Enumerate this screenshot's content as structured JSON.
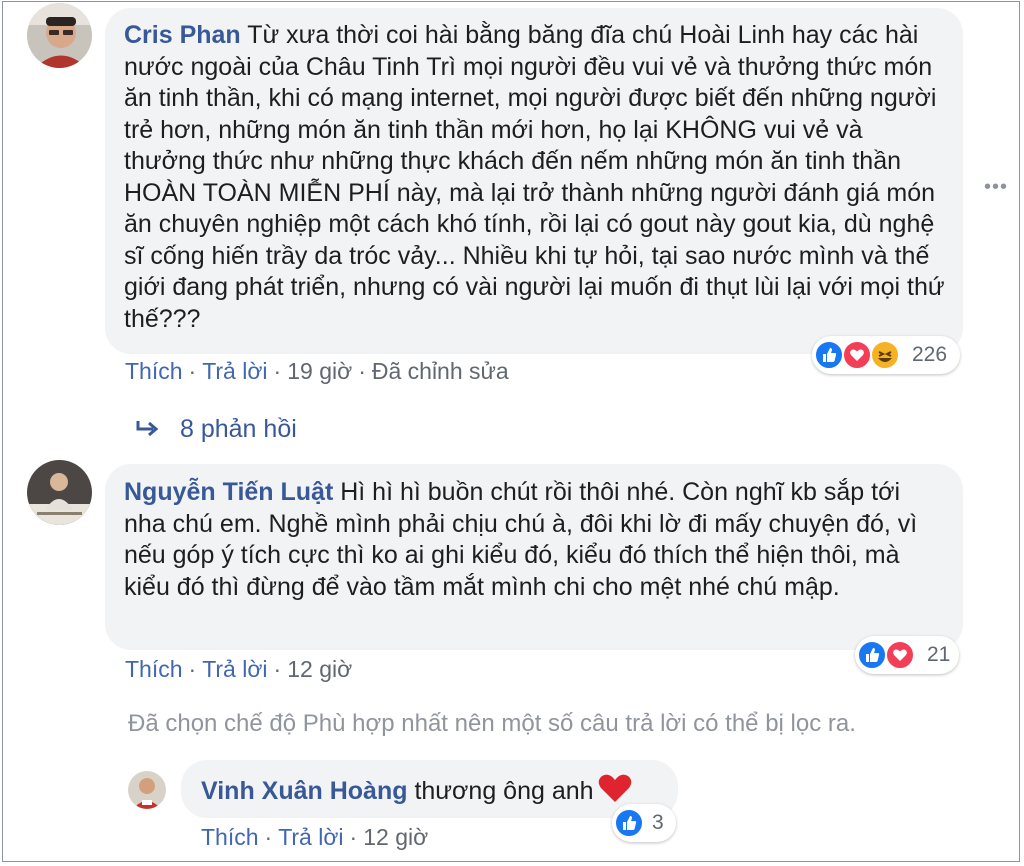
{
  "comment1": {
    "author": "Cris Phan",
    "text": "Từ xưa thời coi hài bằng băng đĩa chú Hoài Linh hay các hài nước ngoài của Châu Tinh Trì mọi người đều vui vẻ và thưởng thức món ăn tinh thần, khi có mạng internet, mọi người được biết đến những người trẻ hơn, những món ăn tinh thần mới hơn, họ lại KHÔNG vui vẻ và thưởng thức như những thực khách đến nếm những món ăn tinh thần HOÀN TOÀN MIỄN PHÍ này, mà lại trở thành những người đánh giá món ăn chuyên nghiệp một cách khó tính, rồi lại có gout này gout kia, dù nghệ sĩ cống hiến trầy da tróc vảy... Nhiều khi tự hỏi, tại sao nước mình và thế giới đang phát triển, nhưng có vài người lại muốn đi thụt lùi lại với mọi thứ thế???",
    "like_label": "Thích",
    "reply_label": "Trả lời",
    "time": "19 giờ",
    "edited": "Đã chỉnh sửa",
    "reaction_count": "226",
    "reactions": [
      "like",
      "love",
      "haha"
    ],
    "more_icon": "more-horizontal-icon"
  },
  "replies_link": {
    "label": "8 phản hồi",
    "icon": "reply-arrow-icon"
  },
  "comment2": {
    "author": "Nguyễn Tiến Luật",
    "text": "Hì hì hì buồn chút rồi thôi nhé. Còn nghĩ kb sắp tới nha chú em. Nghề mình phải chịu chú à, đôi khi lờ đi mấy chuyện đó, vì nếu góp ý tích cực thì ko ai ghi kiểu đó, kiểu đó thích thể hiện thôi, mà kiểu đó thì đừng để vào tầm mắt mình chi cho mệt nhé chú mập.",
    "like_label": "Thích",
    "reply_label": "Trả lời",
    "time": "12 giờ",
    "reaction_count": "21",
    "reactions": [
      "like",
      "love"
    ]
  },
  "filter_notice": "Đã chọn chế độ Phù hợp nhất nên một số câu trả lời có thể bị lọc ra.",
  "comment3": {
    "author": "Vinh Xuân Hoàng",
    "text": "thương ông anh",
    "like_label": "Thích",
    "reply_label": "Trả lời",
    "time": "12 giờ",
    "reaction_count": "3",
    "reactions": [
      "like"
    ]
  },
  "colors": {
    "link": "#385898",
    "action_link": "#4267b2",
    "bubble": "#f2f3f5",
    "like": "#1877f2",
    "love": "#f33e58",
    "haha": "#f7b125"
  }
}
